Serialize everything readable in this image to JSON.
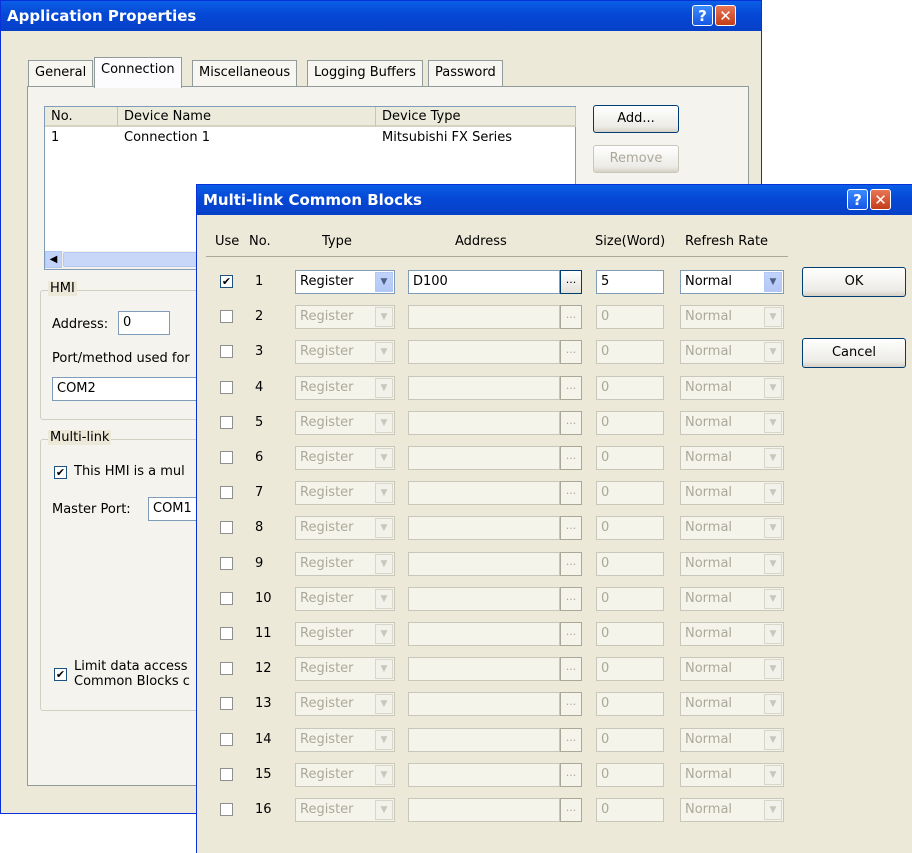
{
  "app_props": {
    "title": "Application Properties",
    "tabs": [
      "General",
      "Connection",
      "Miscellaneous",
      "Logging Buffers",
      "Password"
    ],
    "list": {
      "columns": [
        "No.",
        "Device Name",
        "Device Type"
      ],
      "rows": [
        [
          "1",
          "Connection 1",
          "Mitsubishi FX Series"
        ]
      ]
    },
    "add_label": "Add...",
    "remove_label": "Remove",
    "hmi": {
      "group_label": "HMI",
      "address_label": "Address:",
      "address_value": "0",
      "port_label": "Port/method used for",
      "port_value": "COM2"
    },
    "multilink": {
      "group_label": "Multi-link",
      "checkbox_label": "This HMI is a mul",
      "master_port_label": "Master Port:",
      "master_port_value": "COM1",
      "limit_line1": "Limit data access",
      "limit_line2": "Common Blocks c"
    },
    "help_glyph": "?",
    "close_glyph": "✕"
  },
  "mlcb": {
    "title": "Multi-link Common Blocks",
    "headers": {
      "use": "Use",
      "no": "No.",
      "type": "Type",
      "address": "Address",
      "size": "Size(Word)",
      "refresh": "Refresh Rate"
    },
    "ok_label": "OK",
    "cancel_label": "Cancel",
    "browse_label": "...",
    "help_glyph": "?",
    "close_glyph": "✕",
    "rows": [
      {
        "no": "1",
        "checked": true,
        "type": "Register",
        "address": "D100",
        "size": "5",
        "refresh": "Normal"
      },
      {
        "no": "2",
        "checked": false,
        "type": "Register",
        "address": "",
        "size": "0",
        "refresh": "Normal"
      },
      {
        "no": "3",
        "checked": false,
        "type": "Register",
        "address": "",
        "size": "0",
        "refresh": "Normal"
      },
      {
        "no": "4",
        "checked": false,
        "type": "Register",
        "address": "",
        "size": "0",
        "refresh": "Normal"
      },
      {
        "no": "5",
        "checked": false,
        "type": "Register",
        "address": "",
        "size": "0",
        "refresh": "Normal"
      },
      {
        "no": "6",
        "checked": false,
        "type": "Register",
        "address": "",
        "size": "0",
        "refresh": "Normal"
      },
      {
        "no": "7",
        "checked": false,
        "type": "Register",
        "address": "",
        "size": "0",
        "refresh": "Normal"
      },
      {
        "no": "8",
        "checked": false,
        "type": "Register",
        "address": "",
        "size": "0",
        "refresh": "Normal"
      },
      {
        "no": "9",
        "checked": false,
        "type": "Register",
        "address": "",
        "size": "0",
        "refresh": "Normal"
      },
      {
        "no": "10",
        "checked": false,
        "type": "Register",
        "address": "",
        "size": "0",
        "refresh": "Normal"
      },
      {
        "no": "11",
        "checked": false,
        "type": "Register",
        "address": "",
        "size": "0",
        "refresh": "Normal"
      },
      {
        "no": "12",
        "checked": false,
        "type": "Register",
        "address": "",
        "size": "0",
        "refresh": "Normal"
      },
      {
        "no": "13",
        "checked": false,
        "type": "Register",
        "address": "",
        "size": "0",
        "refresh": "Normal"
      },
      {
        "no": "14",
        "checked": false,
        "type": "Register",
        "address": "",
        "size": "0",
        "refresh": "Normal"
      },
      {
        "no": "15",
        "checked": false,
        "type": "Register",
        "address": "",
        "size": "0",
        "refresh": "Normal"
      },
      {
        "no": "16",
        "checked": false,
        "type": "Register",
        "address": "",
        "size": "0",
        "refresh": "Normal"
      }
    ]
  }
}
